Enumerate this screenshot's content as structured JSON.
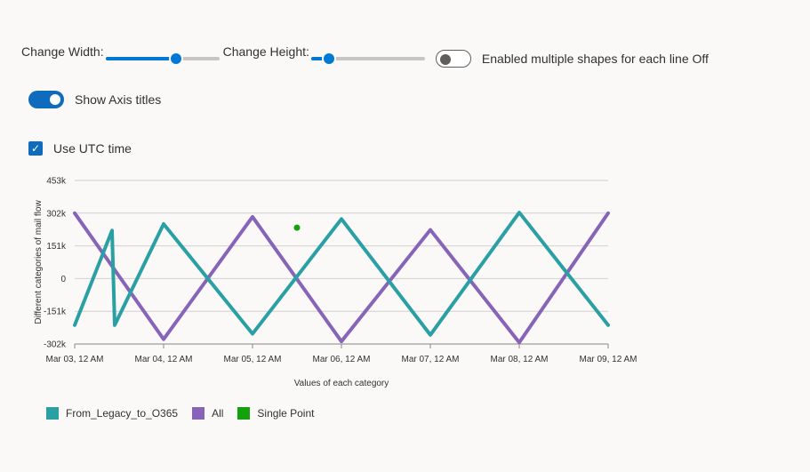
{
  "controls": {
    "width_label": "Change Width:",
    "width_value": 0.62,
    "height_label": "Change Height:",
    "height_value": 0.16,
    "multi_shapes_label": "Enabled multiple shapes for each line Off",
    "multi_shapes_on": false,
    "axis_titles_label": "Show Axis titles",
    "axis_titles_on": true,
    "utc_label": "Use UTC time",
    "utc_checked": true
  },
  "chart_data": {
    "type": "line",
    "xlabel": "Values of each category",
    "ylabel": "Different categories of mail flow",
    "y_ticks": [
      "453k",
      "302k",
      "151k",
      "0",
      "-151k",
      "-302k"
    ],
    "y_tick_values": [
      453000,
      302000,
      151000,
      0,
      -151000,
      -302000
    ],
    "ylim": [
      -302000,
      453000
    ],
    "x_ticks": [
      "Mar 03, 12 AM",
      "Mar 04, 12 AM",
      "Mar 05, 12 AM",
      "Mar 06, 12 AM",
      "Mar 07, 12 AM",
      "Mar 08, 12 AM",
      "Mar 09, 12 AM"
    ],
    "xlim": [
      0,
      6
    ],
    "grid": true,
    "legend_position": "bottom-left",
    "series": [
      {
        "name": "From_Legacy_to_O365",
        "color": "#2aa0a4",
        "x": [
          0,
          0.42,
          0.45,
          1.0,
          2.0,
          3.0,
          4.0,
          5.0,
          6.0
        ],
        "values": [
          -215000,
          222000,
          -215000,
          252000,
          -255000,
          275000,
          -260000,
          305000,
          -215000
        ]
      },
      {
        "name": "All",
        "color": "#8764b8",
        "x": [
          0,
          1.0,
          2.0,
          3.0,
          4.0,
          5.0,
          6.0
        ],
        "values": [
          302000,
          -280000,
          285000,
          -290000,
          225000,
          -295000,
          302000
        ]
      },
      {
        "name": "Single Point",
        "color": "#13a10e",
        "x": [
          2.5
        ],
        "values": [
          235000
        ]
      }
    ]
  }
}
